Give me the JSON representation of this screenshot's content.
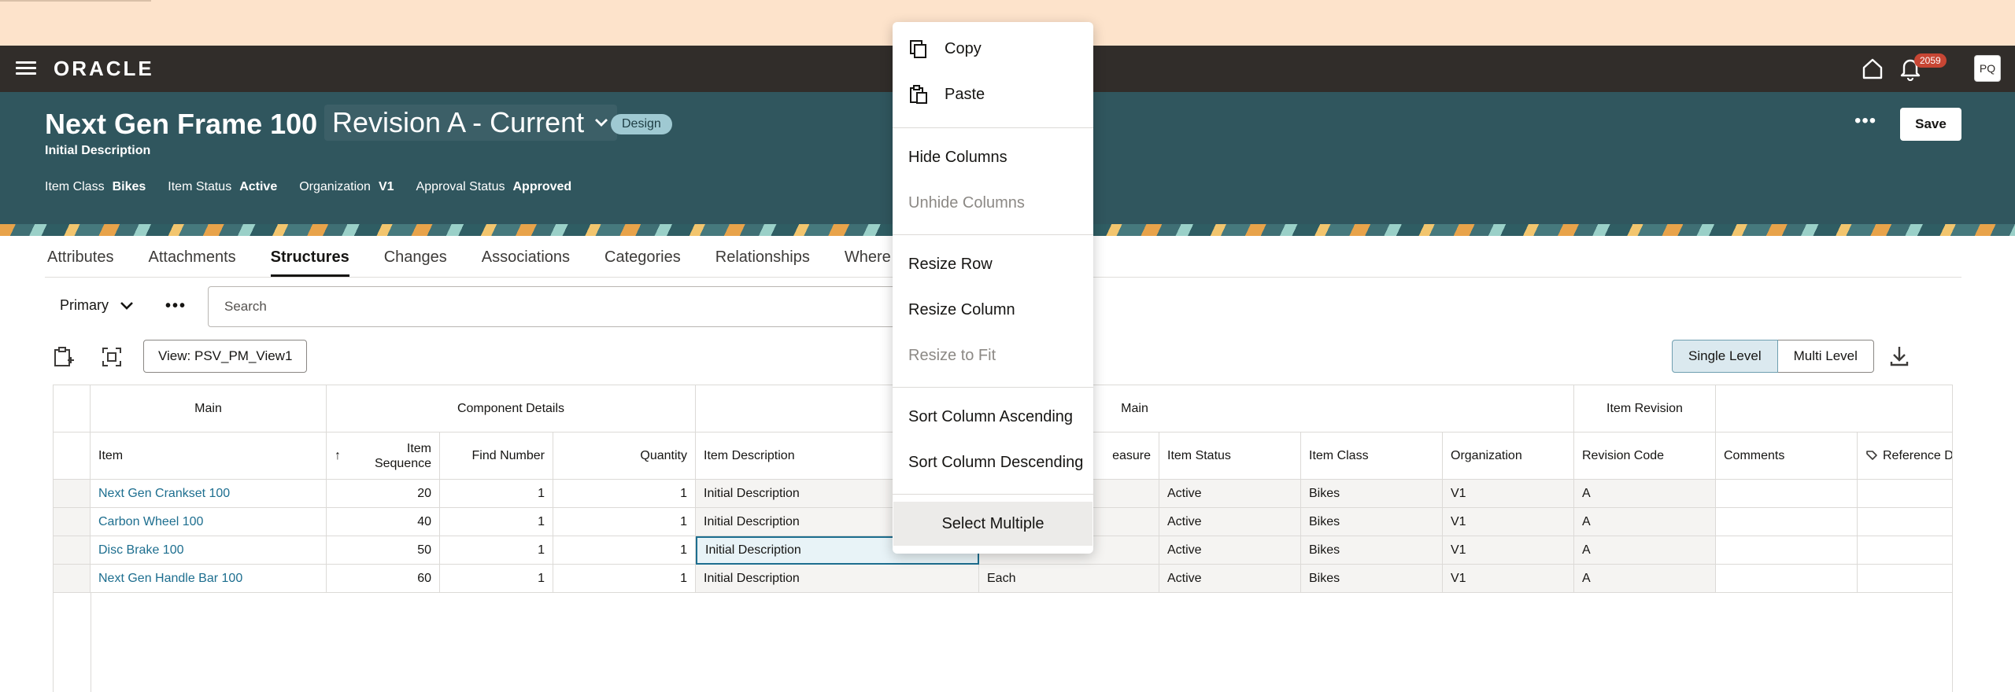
{
  "app": {
    "logo": "ORACLE",
    "notification_count": "2059",
    "user_initials": "PQ"
  },
  "item": {
    "title": "Next Gen Frame 100",
    "revision": "Revision A - Current",
    "lifecycle_badge": "Design",
    "description": "Initial Description",
    "meta": [
      {
        "key": "Item Class",
        "value": "Bikes"
      },
      {
        "key": "Item Status",
        "value": "Active"
      },
      {
        "key": "Organization",
        "value": "V1"
      },
      {
        "key": "Approval Status",
        "value": "Approved"
      }
    ],
    "save_label": "Save"
  },
  "tabs": [
    "Attributes",
    "Attachments",
    "Structures",
    "Changes",
    "Associations",
    "Categories",
    "Relationships",
    "Where"
  ],
  "active_tab": "Structures",
  "structure": {
    "primary_label": "Primary",
    "search_placeholder": "Search",
    "view_label": "View: PSV_PM_View1",
    "single_level": "Single Level",
    "multi_level": "Multi Level"
  },
  "grid": {
    "groups": [
      "Main",
      "Component Details",
      "Main",
      "Item Revision"
    ],
    "headers": [
      "Item",
      "Item Sequence",
      "Find Number",
      "Quantity",
      "Item Description",
      "easure",
      "Item Status",
      "Item Class",
      "Organization",
      "Revision Code",
      "Comments",
      "Reference D"
    ],
    "sort_arrow": "↑",
    "rows": [
      [
        "Next Gen Crankset 100",
        "20",
        "1",
        "1",
        "Initial Description",
        "",
        "Active",
        "Bikes",
        "V1",
        "A",
        "",
        ""
      ],
      [
        "Carbon Wheel 100",
        "40",
        "1",
        "1",
        "Initial Description",
        "",
        "Active",
        "Bikes",
        "V1",
        "A",
        "",
        ""
      ],
      [
        "Disc Brake 100",
        "50",
        "1",
        "1",
        "Initial Description",
        "",
        "Active",
        "Bikes",
        "V1",
        "A",
        "",
        ""
      ],
      [
        "Next Gen Handle Bar 100",
        "60",
        "1",
        "1",
        "Initial Description",
        "Each",
        "Active",
        "Bikes",
        "V1",
        "A",
        "",
        ""
      ]
    ]
  },
  "context_menu": {
    "copy": "Copy",
    "paste": "Paste",
    "hide_columns": "Hide Columns",
    "unhide_columns": "Unhide Columns",
    "resize_row": "Resize Row",
    "resize_column": "Resize Column",
    "resize_to_fit": "Resize to Fit",
    "sort_ascending": "Sort Column Ascending",
    "sort_descending": "Sort Column Descending",
    "select_multiple": "Select Multiple"
  },
  "colors": {
    "appbar": "#312d2a",
    "hero": "#30565e",
    "banner": "#fde3cb",
    "link": "#1d6e8f",
    "badge": "#c74634"
  }
}
